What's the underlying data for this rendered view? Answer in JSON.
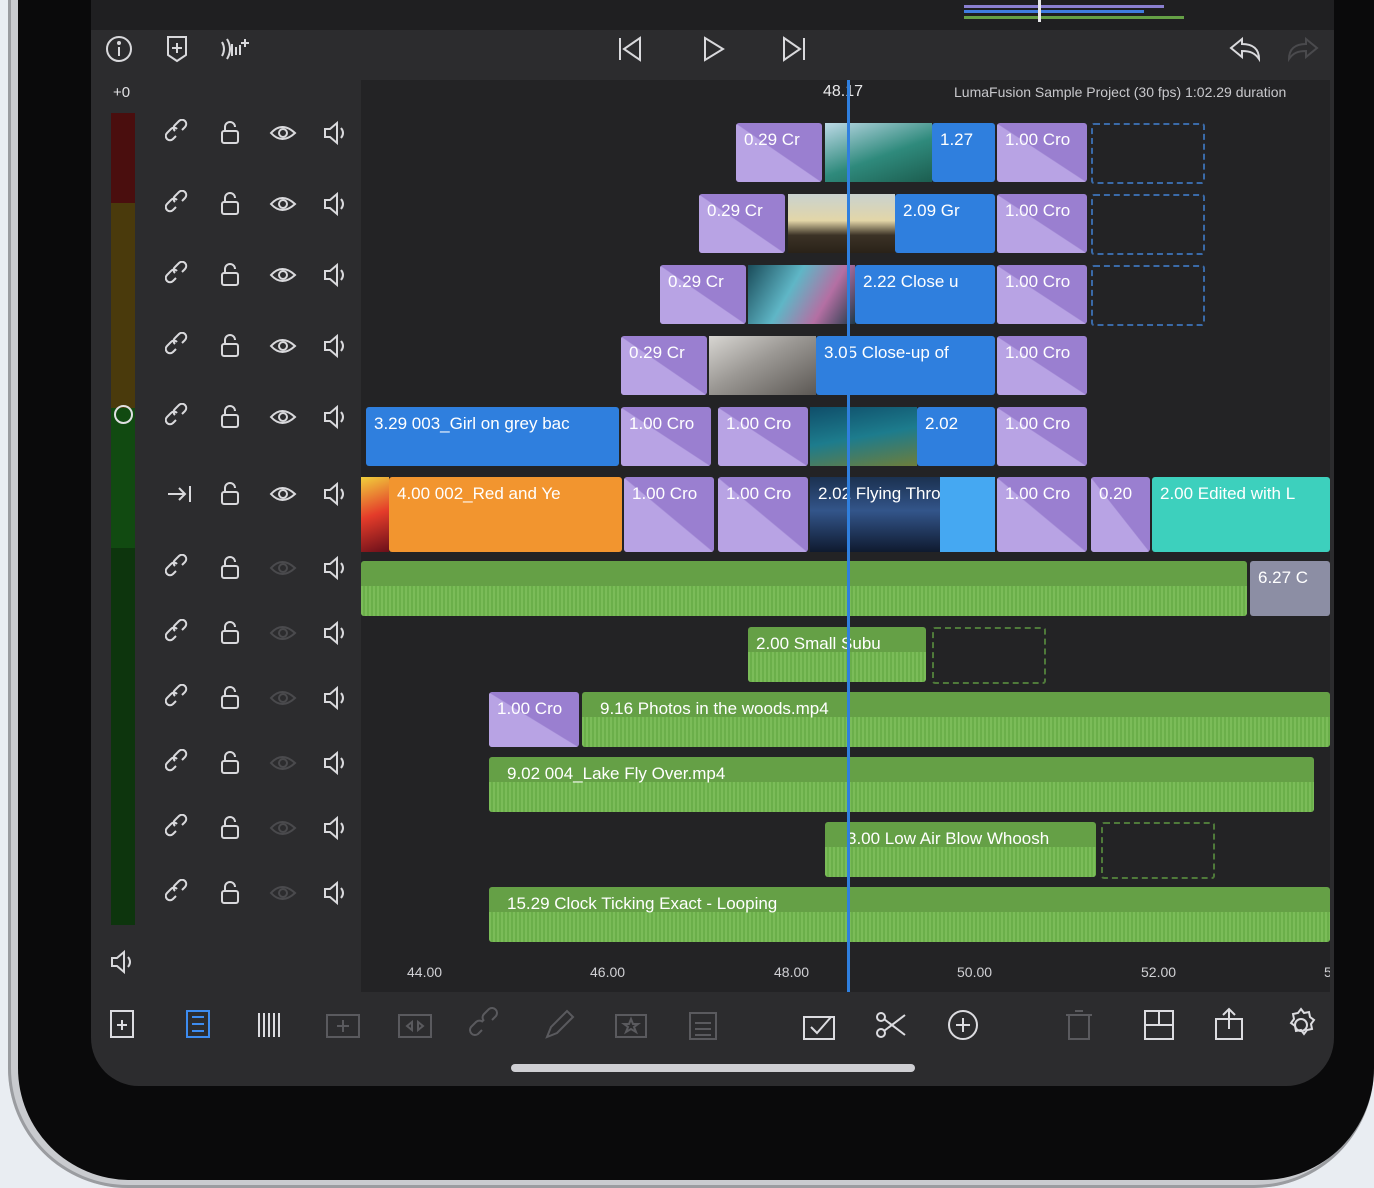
{
  "header": {
    "level_offset": "+0",
    "playhead_time": "48.17",
    "project_info": "LumaFusion Sample Project (30 fps)  1:02.29 duration"
  },
  "ruler": [
    "44.00",
    "46.00",
    "48.00",
    "50.00",
    "52.00",
    "5"
  ],
  "clips": {
    "t1_a": "0.29   Cr",
    "t1_b": "1.27",
    "t1_c": "1.00   Cro",
    "t2_a": "0.29   Cr",
    "t2_b": "2.09   Gr",
    "t2_c": "1.00   Cro",
    "t3_a": "0.29   Cr",
    "t3_b": "2.22   Close u",
    "t3_c": "1.00   Cro",
    "t4_a": "0.29   Cr",
    "t4_b": "3.05   Close-up of",
    "t4_c": "1.00   Cro",
    "t5_a": "3.29   003_Girl on grey bac",
    "t5_b": "1.00   Cro",
    "t5_c": "1.00   Cro",
    "t5_d": "2.02",
    "t5_e": "1.00   Cro",
    "t6_a": "4.00   002_Red and Ye",
    "t6_b": "1.00   Cro",
    "t6_c": "1.00   Cro",
    "t6_d": "2.02   Flying Thro",
    "t6_e": "1.00   Cro",
    "t6_f": "0.20",
    "t6_g": "2.00   Edited with L",
    "a1_b": "6.27   C",
    "a2": "2.00   Small Subu",
    "a3_trans": "1.00   Cro",
    "a3": "9.16   Photos in the woods.mp4",
    "a4": "9.02   004_Lake Fly Over.mp4",
    "a5": "3.00   Low Air Blow Whoosh",
    "a6": "15.29   Clock Ticking Exact - Looping"
  },
  "icons": {
    "top_toolbar": [
      "info-icon",
      "add-marker-icon",
      "voiceover-icon",
      "skip-back-icon",
      "play-icon",
      "skip-forward-icon",
      "undo-icon",
      "redo-icon"
    ],
    "bottom_toolbar": [
      "add-track-icon",
      "track-headers-icon",
      "timeline-view-icon",
      "add-clip-icon",
      "overwrite-icon",
      "link-icon",
      "edit-icon",
      "favorite-icon",
      "clipboard-icon",
      "select-icon",
      "split-icon",
      "add-icon",
      "delete-icon",
      "layout-icon",
      "share-icon",
      "settings-icon"
    ]
  },
  "colors": {
    "video_clip": "#2f7fde",
    "transition": "#9a7fd0",
    "audio_clip": "#65a046",
    "title_clip": "#f2952f",
    "teal_clip": "#3dd0bd",
    "playhead": "#2f7fde"
  }
}
